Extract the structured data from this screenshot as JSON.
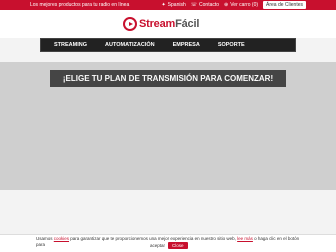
{
  "topbar": {
    "promo": "Los mejores productos para tu radio en línea",
    "links": [
      {
        "icon": "flag-icon",
        "glyph": "✦",
        "label": "Spanish"
      },
      {
        "icon": "phone-icon",
        "glyph": "☏",
        "label": "Contacto"
      },
      {
        "icon": "cart-icon",
        "glyph": "⊕",
        "label": "Ver carro (0)"
      }
    ],
    "client_area": "Área de Clientes"
  },
  "logo": {
    "word_stream": "Stream",
    "word_facil": "Fácil"
  },
  "nav": {
    "items": [
      "STREAMING",
      "AUTOMATIZACIÓN",
      "EMPRESA",
      "SOPORTE"
    ]
  },
  "hero": {
    "title": "¡ELIGE TU PLAN DE TRANSMISIÓN PARA COMENZAR!"
  },
  "cookie": {
    "text_before": "Usamos ",
    "link_cookies": "cookies",
    "text_middle": " para garantizar que te proporcionemos una mejor experiencia en nuestro sitio web, ",
    "link_more": "lee más",
    "text_after": " o haga clic en el botón para",
    "accept": "aceptar",
    "close": "Close"
  },
  "colors": {
    "brand": "#c8102e",
    "nav_bg": "#222222"
  }
}
